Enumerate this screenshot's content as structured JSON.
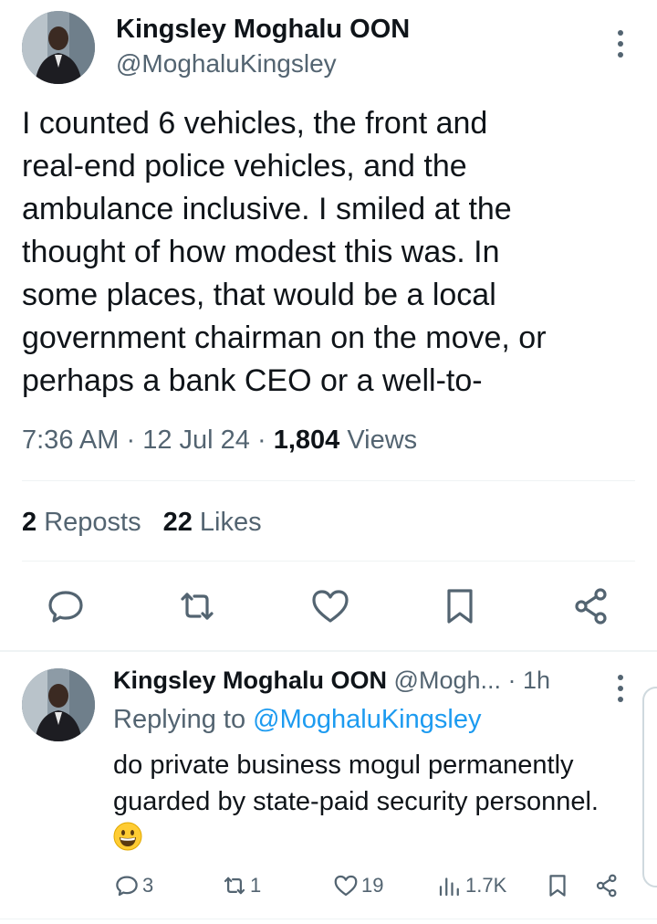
{
  "tweet": {
    "author_name": "Kingsley Moghalu OON",
    "author_handle": "@MoghaluKingsley",
    "text": "I counted 6 vehicles, the front and\nreal-end police vehicles, and the\nambulance inclusive. I smiled at the\nthought of how modest this was. In\nsome places, that would be a local\ngovernment chairman on the move, or\nperhaps a bank CEO or a well-to-",
    "time": "7:36 AM",
    "date": "12 Jul 24",
    "views_count": "1,804",
    "views_label": "Views",
    "separator": "·",
    "reposts_count": "2",
    "reposts_label": "Reposts",
    "likes_count": "22",
    "likes_label": "Likes",
    "actions": [
      "reply-icon",
      "repost-icon",
      "like-icon",
      "bookmark-icon",
      "share-icon"
    ]
  },
  "reply": {
    "author_name": "Kingsley Moghalu OON",
    "author_handle": "@Mogh...",
    "time": "· 1h",
    "replying_prefix": "Replying to",
    "replying_to": "@MoghaluKingsley",
    "text": "do private business mogul permanently guarded by state-paid security personnel.",
    "emoji": "grinning-face-emoji",
    "replies_count": "3",
    "reposts_count": "1",
    "likes_count": "19",
    "views_count": "1.7K"
  },
  "colors": {
    "text_primary": "#0f1419",
    "text_secondary": "#536471",
    "link": "#1d9bf0",
    "divider": "#eff3f4"
  }
}
